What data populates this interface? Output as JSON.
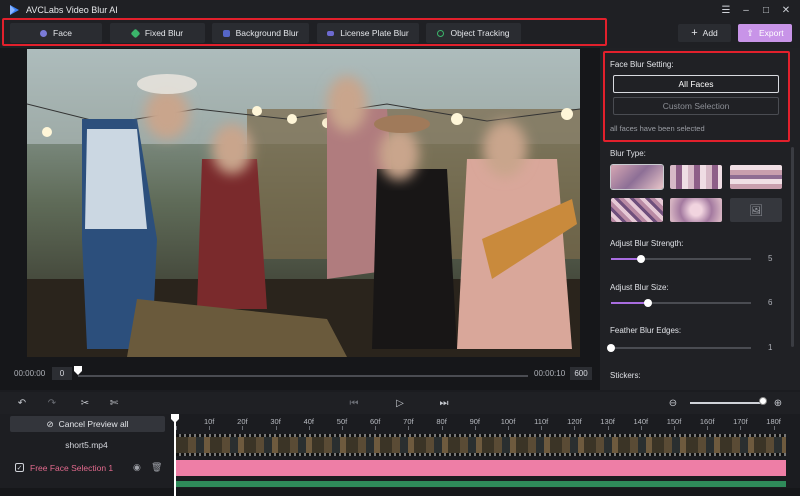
{
  "app": {
    "title": "AVCLabs Video Blur AI"
  },
  "toolbar": {
    "tools": [
      {
        "label": "Face",
        "color": "#7b7bd8"
      },
      {
        "label": "Fixed Blur",
        "color": "#3bb56b"
      },
      {
        "label": "Background Blur",
        "color": "#5566c8"
      },
      {
        "label": "License Plate Blur",
        "color": "#6d6ad0"
      },
      {
        "label": "Object Tracking",
        "color": "#3bb56b"
      }
    ],
    "add_label": "Add",
    "export_label": "Export"
  },
  "preview": {
    "time_start": "00:00:00",
    "frame_start": "0",
    "time_end": "00:00:10",
    "frame_end": "600"
  },
  "side": {
    "setting_title": "Face Blur Setting:",
    "all_faces": "All Faces",
    "custom_selection": "Custom Selection",
    "hint": "all faces have been selected",
    "blur_type_label": "Blur Type:",
    "strength_label": "Adjust Blur Strength:",
    "strength_value": "5",
    "size_label": "Adjust Blur Size:",
    "size_value": "6",
    "feather_label": "Feather Blur Edges:",
    "feather_value": "1",
    "stickers_label": "Stickers:"
  },
  "timeline": {
    "cancel_preview": "Cancel Preview all",
    "file_name": "short5.mp4",
    "tracks": [
      {
        "name": "Free Face Selection 1",
        "checked": true
      }
    ],
    "ruler": [
      "0f",
      "10f",
      "20f",
      "30f",
      "40f",
      "50f",
      "60f",
      "70f",
      "80f",
      "90f",
      "100f",
      "110f",
      "120f",
      "130f",
      "140f",
      "150f",
      "160f",
      "170f",
      "180f"
    ]
  },
  "colors": {
    "accent": "#a86de0",
    "export": "#c894e8",
    "highlight": "#e2202c",
    "track": "#ee7ea6"
  }
}
